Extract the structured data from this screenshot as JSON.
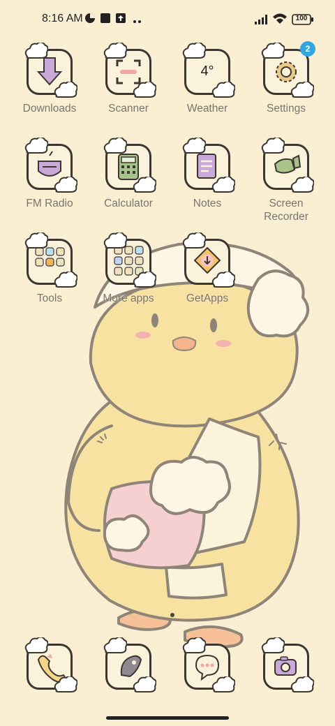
{
  "status_bar": {
    "time": "8:16 AM",
    "battery_level": "100",
    "icons": [
      "data-saver-icon",
      "square-notification-icon",
      "upload-icon",
      "more-dots-icon",
      "signal-icon",
      "wifi-icon",
      "battery-icon"
    ]
  },
  "apps": [
    {
      "label": "Downloads",
      "icon": "download-arrow-icon"
    },
    {
      "label": "Scanner",
      "icon": "scan-frame-icon"
    },
    {
      "label": "Weather",
      "icon": "weather-icon",
      "glyph_text": "4°"
    },
    {
      "label": "Settings",
      "icon": "gear-icon",
      "badge": "2"
    },
    {
      "label": "FM Radio",
      "icon": "radio-icon"
    },
    {
      "label": "Calculator",
      "icon": "calculator-icon"
    },
    {
      "label": "Notes",
      "icon": "notes-icon"
    },
    {
      "label": "Screen\nRecorder",
      "icon": "video-camera-icon"
    },
    {
      "label": "Tools",
      "icon": "folder-icon"
    },
    {
      "label": "More apps",
      "icon": "folder-icon"
    },
    {
      "label": "GetApps",
      "icon": "getapps-icon"
    }
  ],
  "dock": [
    {
      "name": "phone-icon"
    },
    {
      "name": "contacts-icon"
    },
    {
      "name": "messages-icon"
    },
    {
      "name": "camera-icon"
    }
  ],
  "colors": {
    "background": "#faefd2",
    "tile_border": "#3c3631",
    "label": "#7a736a",
    "badge": "#33a7e0"
  }
}
